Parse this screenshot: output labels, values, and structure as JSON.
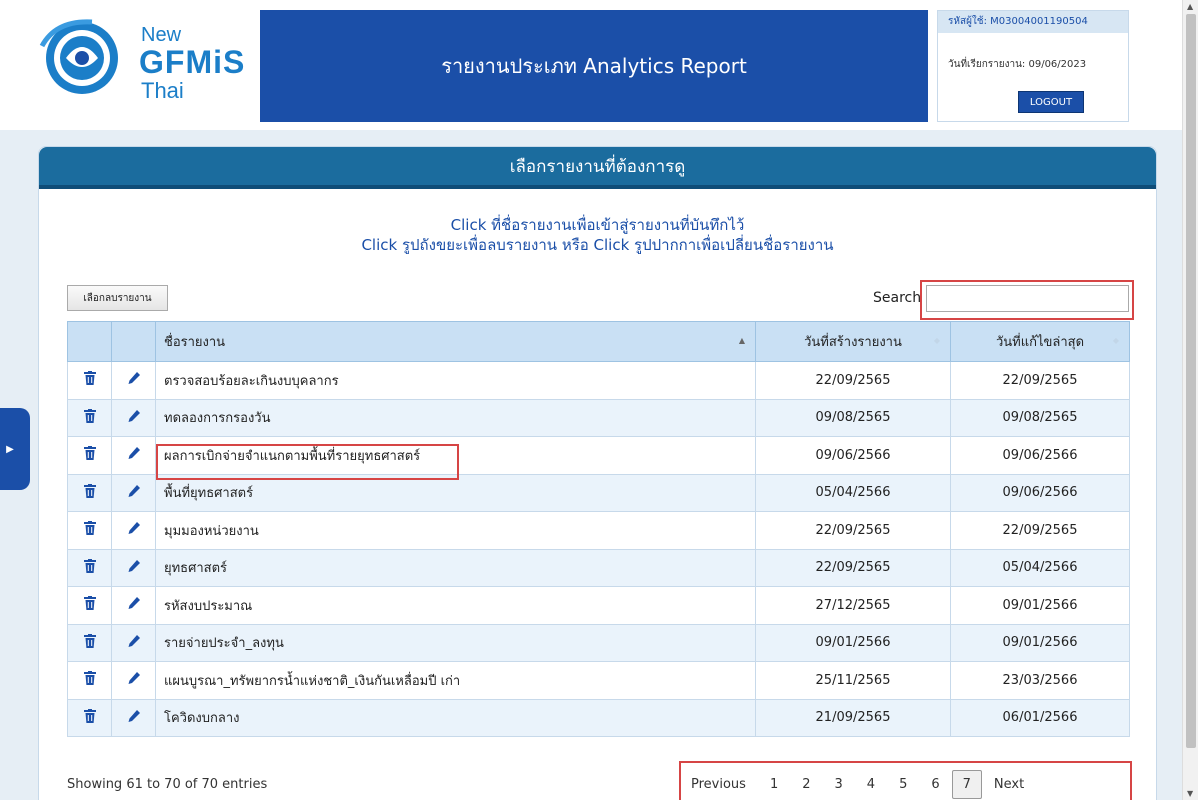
{
  "header": {
    "logo": {
      "new": "New",
      "gfmis": "GFMiS",
      "thai": "Thai"
    },
    "report_title": "รายงานประเภท Analytics Report",
    "user_id": "รหัสผู้ใช้: M03004001190504",
    "report_date": "วันที่เรียกรายงาน: 09/06/2023",
    "logout_label": "LOGOUT"
  },
  "panel": {
    "title": "เลือกรายงานที่ต้องการดู",
    "instruction_line1": "Click ที่ชื่อรายงานเพื่อเข้าสู่รายงานที่บันทึกไว้",
    "instruction_line2": "Click รูปถังขยะเพื่อลบรายงาน หรือ Click รูปปากกาเพื่อเปลี่ยนชื่อรายงาน",
    "delete_selected_label": "เลือกลบรายงาน",
    "search_label": "Search",
    "search_value": ""
  },
  "table": {
    "columns": [
      "",
      "",
      "ชื่อรายงาน",
      "วันที่สร้างรายงาน",
      "วันที่แก้ไขล่าสุด"
    ],
    "rows": [
      {
        "name": "ตรวจสอบร้อยละเกินงบบุคลากร",
        "created": "22/09/2565",
        "modified": "22/09/2565"
      },
      {
        "name": "ทดลองการกรองวัน",
        "created": "09/08/2565",
        "modified": "09/08/2565"
      },
      {
        "name": "ผลการเบิกจ่ายจำแนกตามพื้นที่รายยุทธศาสตร์",
        "created": "09/06/2566",
        "modified": "09/06/2566"
      },
      {
        "name": "พื้นที่ยุทธศาสตร์",
        "created": "05/04/2566",
        "modified": "09/06/2566"
      },
      {
        "name": "มุมมองหน่วยงาน",
        "created": "22/09/2565",
        "modified": "22/09/2565"
      },
      {
        "name": "ยุทธศาสตร์",
        "created": "22/09/2565",
        "modified": "05/04/2566"
      },
      {
        "name": "รหัสงบประมาณ",
        "created": "27/12/2565",
        "modified": "09/01/2566"
      },
      {
        "name": "รายจ่ายประจำ_ลงทุน",
        "created": "09/01/2566",
        "modified": "09/01/2566"
      },
      {
        "name": "แผนบูรณา_ทรัพยากรน้ำแห่งชาติ_เงินกันเหลื่อมปี เก่า",
        "created": "25/11/2565",
        "modified": "23/03/2566"
      },
      {
        "name": "โควิดงบกลาง",
        "created": "21/09/2565",
        "modified": "06/01/2566"
      }
    ]
  },
  "footer": {
    "showing": "Showing 61 to 70 of 70 entries",
    "pagination": [
      "Previous",
      "1",
      "2",
      "3",
      "4",
      "5",
      "6",
      "7",
      "Next"
    ],
    "current_page": "7"
  },
  "colors": {
    "banner": "#1b4fa8",
    "panel_header": "#1b6c9e",
    "table_header": "#c9e0f4",
    "highlight": "#d64545"
  }
}
